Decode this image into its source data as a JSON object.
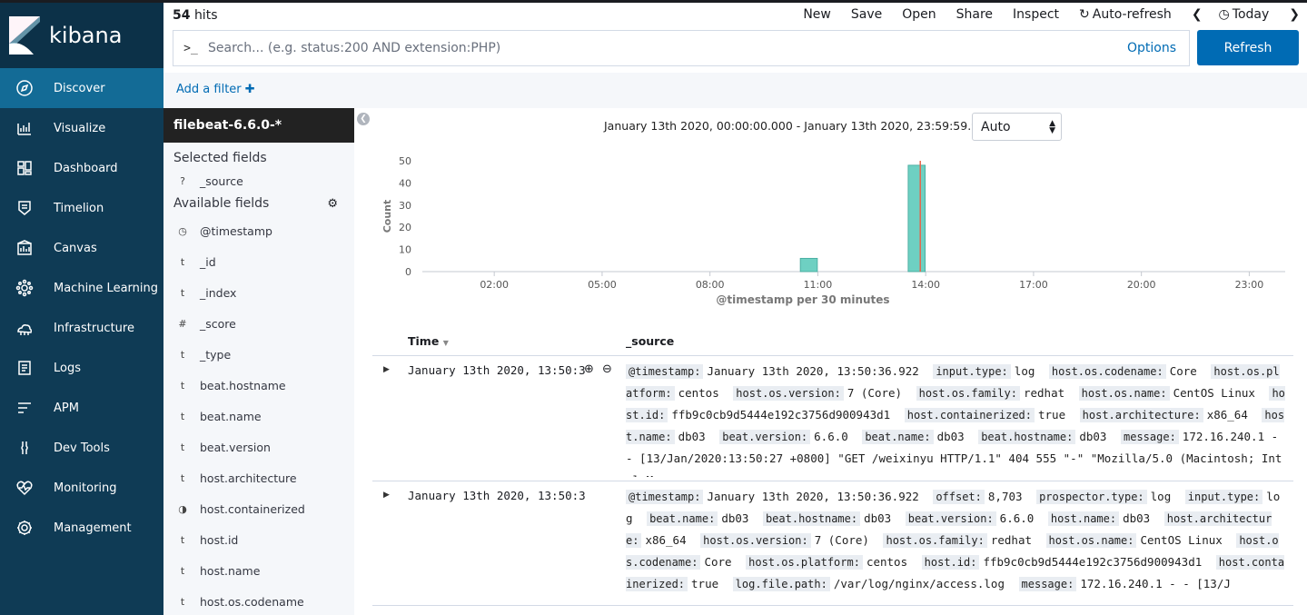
{
  "app": {
    "brand": "kibana"
  },
  "nav": [
    {
      "label": "Discover",
      "icon": "compass-icon",
      "active": true
    },
    {
      "label": "Visualize",
      "icon": "visualize-icon"
    },
    {
      "label": "Dashboard",
      "icon": "dashboard-icon"
    },
    {
      "label": "Timelion",
      "icon": "timelion-icon"
    },
    {
      "label": "Canvas",
      "icon": "canvas-icon"
    },
    {
      "label": "Machine Learning",
      "icon": "machine-learning-icon"
    },
    {
      "label": "Infrastructure",
      "icon": "infrastructure-icon"
    },
    {
      "label": "Logs",
      "icon": "logs-icon"
    },
    {
      "label": "APM",
      "icon": "apm-icon"
    },
    {
      "label": "Dev Tools",
      "icon": "dev-tools-icon"
    },
    {
      "label": "Monitoring",
      "icon": "monitoring-icon"
    },
    {
      "label": "Management",
      "icon": "gear-icon"
    }
  ],
  "header": {
    "hits_count": "54",
    "hits_label": "hits",
    "menu": {
      "new": "New",
      "save": "Save",
      "open": "Open",
      "share": "Share",
      "inspect": "Inspect",
      "auto_refresh": "Auto-refresh",
      "today": "Today"
    }
  },
  "search": {
    "prompt": ">_",
    "placeholder": "Search... (e.g. status:200 AND extension:PHP)",
    "value": "",
    "options_label": "Options",
    "refresh_label": "Refresh"
  },
  "filters": {
    "add_label": "Add a filter"
  },
  "fields": {
    "index_pattern": "filebeat-6.6.0-*",
    "selected_title": "Selected fields",
    "selected": [
      {
        "type": "?",
        "name": "_source"
      }
    ],
    "available_title": "Available fields",
    "available": [
      {
        "type": "clock",
        "name": "@timestamp"
      },
      {
        "type": "t",
        "name": "_id"
      },
      {
        "type": "t",
        "name": "_index"
      },
      {
        "type": "#",
        "name": "_score"
      },
      {
        "type": "t",
        "name": "_type"
      },
      {
        "type": "t",
        "name": "beat.hostname"
      },
      {
        "type": "t",
        "name": "beat.name"
      },
      {
        "type": "t",
        "name": "beat.version"
      },
      {
        "type": "t",
        "name": "host.architecture"
      },
      {
        "type": "bool",
        "name": "host.containerized"
      },
      {
        "type": "t",
        "name": "host.id"
      },
      {
        "type": "t",
        "name": "host.name"
      },
      {
        "type": "t",
        "name": "host.os.codename"
      }
    ]
  },
  "timerange": {
    "label": "January 13th 2020, 00:00:00.000 - January 13th 2020, 23:59:59.999 —",
    "interval": "Auto"
  },
  "chart_data": {
    "type": "bar",
    "title": "",
    "xlabel": "@timestamp per 30 minutes",
    "ylabel": "Count",
    "ylim": [
      0,
      50
    ],
    "yticks": [
      0,
      10,
      20,
      30,
      40,
      50
    ],
    "xlim_hours": [
      0,
      24
    ],
    "xticks": [
      {
        "hour": 2,
        "label": "02:00"
      },
      {
        "hour": 5,
        "label": "05:00"
      },
      {
        "hour": 8,
        "label": "08:00"
      },
      {
        "hour": 11,
        "label": "11:00"
      },
      {
        "hour": 14,
        "label": "14:00"
      },
      {
        "hour": 17,
        "label": "17:00"
      },
      {
        "hour": 20,
        "label": "20:00"
      },
      {
        "hour": 23,
        "label": "23:00"
      }
    ],
    "bars": [
      {
        "start_hour": 10.5,
        "value": 6
      },
      {
        "start_hour": 13.5,
        "value": 48
      }
    ],
    "current_time_hour": 13.85,
    "bar_color": "#6ed0c2",
    "marker_color": "#e7664c"
  },
  "table": {
    "col_time": "Time",
    "col_source": "_source",
    "rows": [
      {
        "time": "January 13th 2020, 13:50:36.922",
        "source": [
          [
            "@timestamp:",
            "January 13th 2020, 13:50:36.922"
          ],
          [
            "input.type:",
            "log"
          ],
          [
            "host.os.codename:",
            "Core"
          ],
          [
            "host.os.platform:",
            "centos"
          ],
          [
            "host.os.version:",
            "7 (Core)"
          ],
          [
            "host.os.family:",
            "redhat"
          ],
          [
            "host.os.name:",
            "CentOS Linux"
          ],
          [
            "host.id:",
            "ffb9c0cb9d5444e192c3756d900943d1"
          ],
          [
            "host.containerized:",
            "true"
          ],
          [
            "host.architecture:",
            "x86_64"
          ],
          [
            "host.name:",
            "db03"
          ],
          [
            "beat.version:",
            "6.6.0"
          ],
          [
            "beat.name:",
            "db03"
          ],
          [
            "beat.hostname:",
            "db03"
          ],
          [
            "message:",
            "172.16.240.1 - - [13/Jan/2020:13:50:27 +0800] \"GET /weixinyu HTTP/1.1\" 404 555 \"-\" \"Mozilla/5.0 (Macintosh; Intel M"
          ]
        ]
      },
      {
        "time": "January 13th 2020, 13:50:36.922",
        "source": [
          [
            "@timestamp:",
            "January 13th 2020, 13:50:36.922"
          ],
          [
            "offset:",
            "8,703"
          ],
          [
            "prospector.type:",
            "log"
          ],
          [
            "input.type:",
            "log"
          ],
          [
            "beat.name:",
            "db03"
          ],
          [
            "beat.hostname:",
            "db03"
          ],
          [
            "beat.version:",
            "6.6.0"
          ],
          [
            "host.name:",
            "db03"
          ],
          [
            "host.architecture:",
            "x86_64"
          ],
          [
            "host.os.version:",
            "7 (Core)"
          ],
          [
            "host.os.family:",
            "redhat"
          ],
          [
            "host.os.name:",
            "CentOS Linux"
          ],
          [
            "host.os.codename:",
            "Core"
          ],
          [
            "host.os.platform:",
            "centos"
          ],
          [
            "host.id:",
            "ffb9c0cb9d5444e192c3756d900943d1"
          ],
          [
            "host.containerized:",
            "true"
          ],
          [
            "log.file.path:",
            "/var/log/nginx/access.log"
          ],
          [
            "message:",
            "172.16.240.1 - - [13/J"
          ]
        ]
      }
    ]
  }
}
